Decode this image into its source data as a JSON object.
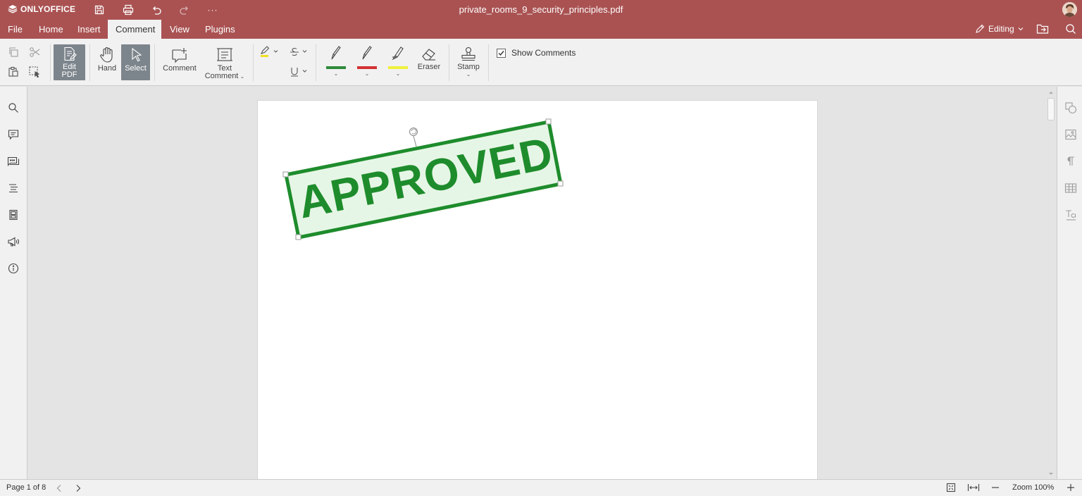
{
  "app": {
    "logo_text": "ONLYOFFICE",
    "document_title": "private_rooms_9_security_principles.pdf"
  },
  "titlebar": {
    "icons": [
      "save-icon",
      "print-icon",
      "undo-icon",
      "redo-icon",
      "more-icon"
    ],
    "more_label": "···"
  },
  "menu": {
    "tabs": [
      "File",
      "Home",
      "Insert",
      "Comment",
      "View",
      "Plugins"
    ],
    "active_tab": "Comment",
    "mode_label": "Editing"
  },
  "toolbar": {
    "edit_pdf_line1": "Edit",
    "edit_pdf_line2": "PDF",
    "hand_label": "Hand",
    "select_label": "Select",
    "comment_label": "Comment",
    "text_comment_line1": "Text",
    "text_comment_line2": "Comment",
    "pen_colors": [
      "#2e8b3a",
      "#d43232",
      "#f0f03c"
    ],
    "highlight_color": "#f0e020",
    "eraser_label": "Eraser",
    "stamp_label": "Stamp",
    "show_comments_label": "Show Comments",
    "show_comments_checked": true
  },
  "stamp": {
    "text": "APPROVED",
    "color": "#1e8c2c",
    "fill": "#e6f6e6"
  },
  "statusbar": {
    "page_label": "Page 1 of 8",
    "zoom_label": "Zoom 100%"
  },
  "colors": {
    "brand": "#aa5252",
    "toolbar_bg": "#f1f1f1",
    "workspace_bg": "#e4e4e4",
    "pressed": "#7d858c"
  }
}
